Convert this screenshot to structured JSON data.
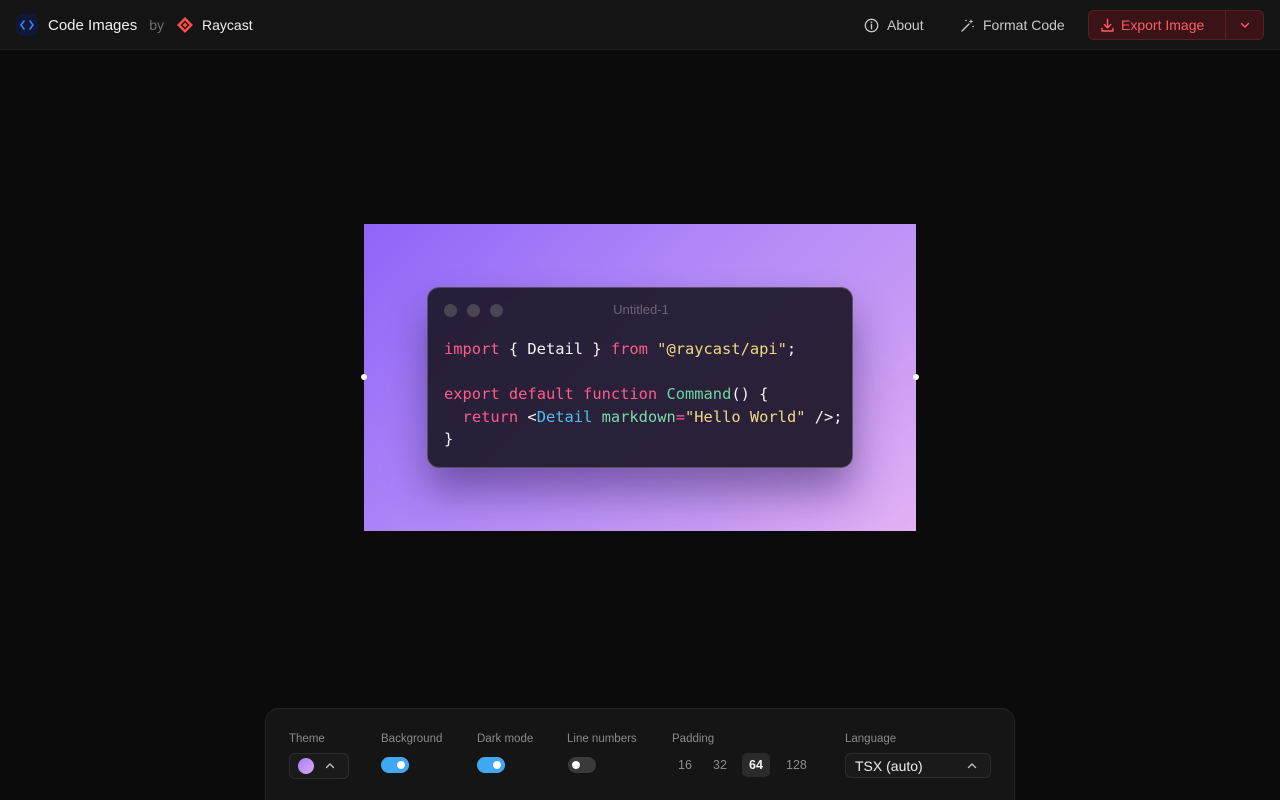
{
  "header": {
    "app_name": "Code Images",
    "by_text": "by",
    "brand_name": "Raycast",
    "about_label": "About",
    "format_label": "Format Code",
    "export_label": "Export Image"
  },
  "preview": {
    "window_title": "Untitled-1",
    "code_lines": [
      [
        [
          "kw",
          "import"
        ],
        [
          "plain",
          " { Detail } "
        ],
        [
          "kw",
          "from"
        ],
        [
          "plain",
          " "
        ],
        [
          "str",
          "\"@raycast/api\""
        ],
        [
          "plain",
          ";"
        ]
      ],
      [],
      [
        [
          "kw",
          "export"
        ],
        [
          "plain",
          " "
        ],
        [
          "kw",
          "default"
        ],
        [
          "plain",
          " "
        ],
        [
          "kw",
          "function"
        ],
        [
          "plain",
          " "
        ],
        [
          "fn",
          "Command"
        ],
        [
          "plain",
          "() {"
        ]
      ],
      [
        [
          "plain",
          "  "
        ],
        [
          "kw",
          "return"
        ],
        [
          "plain",
          " <"
        ],
        [
          "tag",
          "Detail"
        ],
        [
          "plain",
          " "
        ],
        [
          "attr",
          "markdown"
        ],
        [
          "kw",
          "="
        ],
        [
          "str",
          "\"Hello World\""
        ],
        [
          "plain",
          " />;"
        ]
      ],
      [
        [
          "plain",
          "}"
        ]
      ]
    ]
  },
  "controls": {
    "theme_label": "Theme",
    "background_label": "Background",
    "background_on": true,
    "darkmode_label": "Dark mode",
    "darkmode_on": true,
    "linenumbers_label": "Line numbers",
    "linenumbers_on": false,
    "padding_label": "Padding",
    "padding_options": [
      "16",
      "32",
      "64",
      "128"
    ],
    "padding_selected": "64",
    "language_label": "Language",
    "language_value": "TSX (auto)"
  },
  "colors": {
    "accent": "#3ea9f2",
    "export_red": "#ff5a66",
    "gradient_start": "#8e65f7",
    "gradient_end": "#e3b1f3"
  },
  "icons": {
    "app_logo": "code-brackets-icon",
    "brand_logo": "raycast-icon",
    "about": "info-icon",
    "format": "magic-wand-icon",
    "export": "download-icon",
    "export_menu": "chevron-down-icon",
    "theme_menu": "chevron-up-icon",
    "language_menu": "chevron-up-icon"
  }
}
